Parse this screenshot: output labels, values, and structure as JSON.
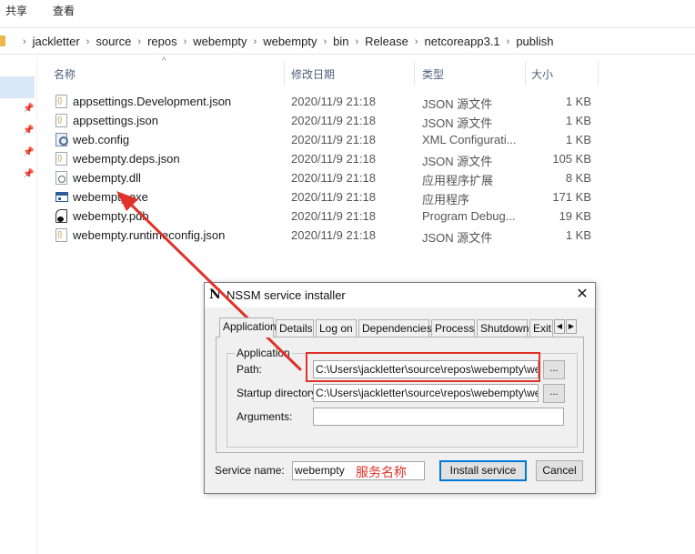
{
  "ribbon": {
    "tab_share": "共享",
    "tab_view": "查看"
  },
  "address": {
    "crumbs": [
      "jackletter",
      "source",
      "repos",
      "webempty",
      "webempty",
      "bin",
      "Release",
      "netcoreapp3.1",
      "publish"
    ]
  },
  "columns": {
    "name": "名称",
    "modified": "修改日期",
    "type": "类型",
    "size": "大小"
  },
  "files": [
    {
      "name": "appsettings.Development.json",
      "date": "2020/11/9 21:18",
      "type": "JSON 源文件",
      "size": "1 KB",
      "icon": "json-file-icon"
    },
    {
      "name": "appsettings.json",
      "date": "2020/11/9 21:18",
      "type": "JSON 源文件",
      "size": "1 KB",
      "icon": "json-file-icon"
    },
    {
      "name": "web.config",
      "date": "2020/11/9 21:18",
      "type": "XML Configurati...",
      "size": "1 KB",
      "icon": "config-file-icon"
    },
    {
      "name": "webempty.deps.json",
      "date": "2020/11/9 21:18",
      "type": "JSON 源文件",
      "size": "105 KB",
      "icon": "json-file-icon"
    },
    {
      "name": "webempty.dll",
      "date": "2020/11/9 21:18",
      "type": "应用程序扩展",
      "size": "8 KB",
      "icon": "dll-file-icon"
    },
    {
      "name": "webempty.exe",
      "date": "2020/11/9 21:18",
      "type": "应用程序",
      "size": "171 KB",
      "icon": "exe-file-icon"
    },
    {
      "name": "webempty.pdb",
      "date": "2020/11/9 21:18",
      "type": "Program Debug...",
      "size": "19 KB",
      "icon": "pdb-file-icon"
    },
    {
      "name": "webempty.runtimeconfig.json",
      "date": "2020/11/9 21:18",
      "type": "JSON 源文件",
      "size": "1 KB",
      "icon": "json-file-icon"
    }
  ],
  "dialog": {
    "title": "NSSM service installer",
    "logo": "N",
    "tabs": [
      "Application",
      "Details",
      "Log on",
      "Dependencies",
      "Process",
      "Shutdown",
      "Exit"
    ],
    "group_label": "Application",
    "path_label": "Path:",
    "path_value": "C:\\Users\\jackletter\\source\\repos\\webempty\\webempty",
    "startup_label": "Startup directory:",
    "startup_value": "C:\\Users\\jackletter\\source\\repos\\webempty\\webempty",
    "arguments_label": "Arguments:",
    "arguments_value": "",
    "browse_label": "...",
    "service_name_label": "Service name:",
    "service_name_value": "webempty",
    "service_name_annotation": "服务名称",
    "install_label": "Install service",
    "cancel_label": "Cancel",
    "close_glyph": "✕"
  },
  "colors": {
    "annotation": "#e0322a",
    "selection": "#d9e8f7"
  }
}
